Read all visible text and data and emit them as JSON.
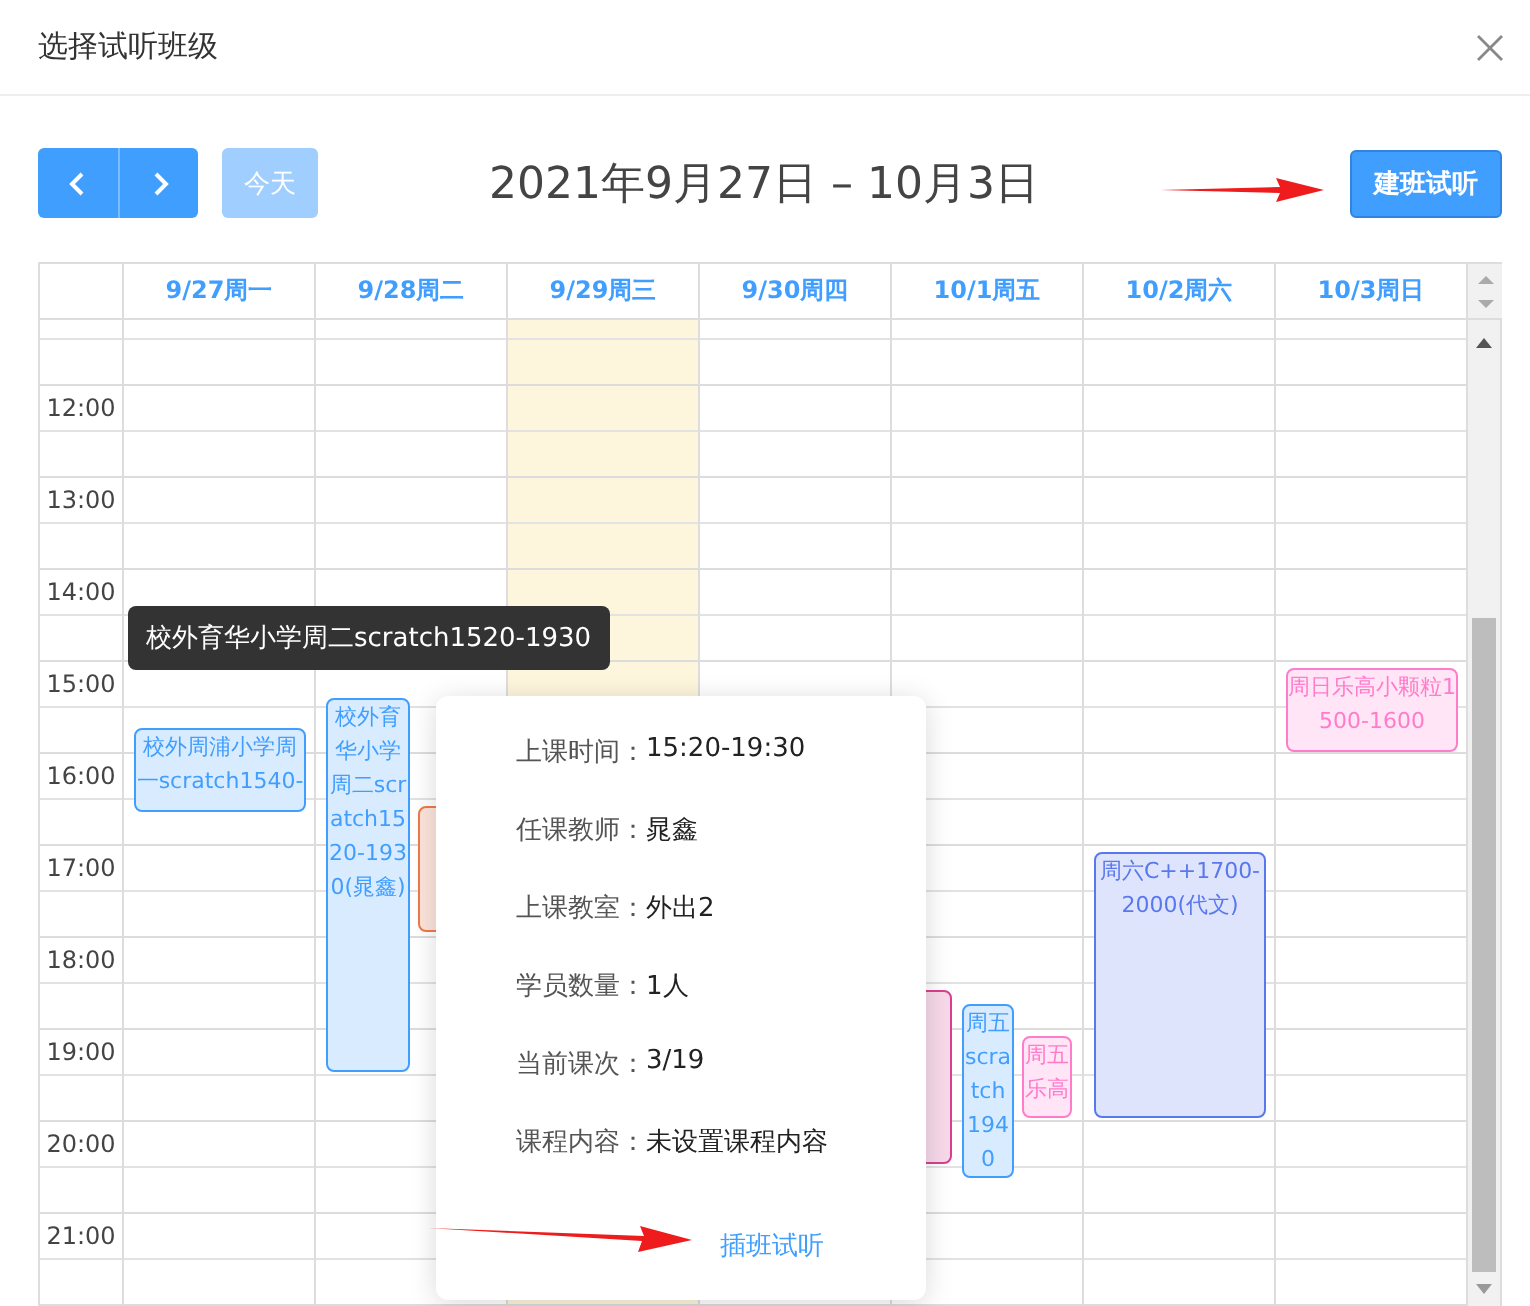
{
  "dialog": {
    "title": "选择试听班级"
  },
  "toolbar": {
    "today_button": {
      "label": "今天",
      "disabled": true
    },
    "date_range": "2021年9月27日 – 10月3日",
    "create_button": "建班试听"
  },
  "calendar": {
    "hours": [
      "12:00",
      "13:00",
      "14:00",
      "15:00",
      "16:00",
      "17:00",
      "18:00",
      "19:00",
      "20:00",
      "21:00"
    ],
    "days": [
      {
        "label": "9/27周一",
        "today": false,
        "events": [
          {
            "title": "校外周浦小学周一scratch1540-",
            "color": "#409eff"
          }
        ]
      },
      {
        "label": "9/28周二",
        "today": false,
        "events": [
          {
            "title": "校外育华小学周二scratch1520-1930(晁鑫)",
            "color": "#409eff"
          },
          {
            "color": "#f0784a"
          }
        ]
      },
      {
        "label": "9/29周三",
        "today": true
      },
      {
        "label": "9/30周四",
        "today": false
      },
      {
        "label": "10/1周五",
        "today": false,
        "events": [
          {
            "color": "#d9408f"
          },
          {
            "title": "周五scratch1940",
            "color": "#409eff"
          },
          {
            "title": "周五乐高",
            "color": "#ff7ccb"
          }
        ]
      },
      {
        "label": "10/2周六",
        "today": false,
        "events": [
          {
            "title": "周六C++1700-2000(代文)",
            "color": "#5a78ee"
          }
        ]
      },
      {
        "label": "10/3周日",
        "today": false,
        "events": [
          {
            "title": "周日乐高小颗粒1500-1600",
            "color": "#ff7ccb"
          }
        ]
      }
    ]
  },
  "tooltip": {
    "text": "校外育华小学周二scratch1520-1930"
  },
  "popover": {
    "rows": [
      {
        "label": "上课时间：",
        "value": "15:20-19:30"
      },
      {
        "label": "任课教师：",
        "value": "晁鑫"
      },
      {
        "label": "上课教室：",
        "value": "外出2"
      },
      {
        "label": "学员数量：",
        "value": "1人"
      },
      {
        "label": "当前课次：",
        "value": "3/19"
      },
      {
        "label": "课程内容：",
        "value": "未设置课程内容"
      }
    ],
    "link": "插班试听"
  }
}
